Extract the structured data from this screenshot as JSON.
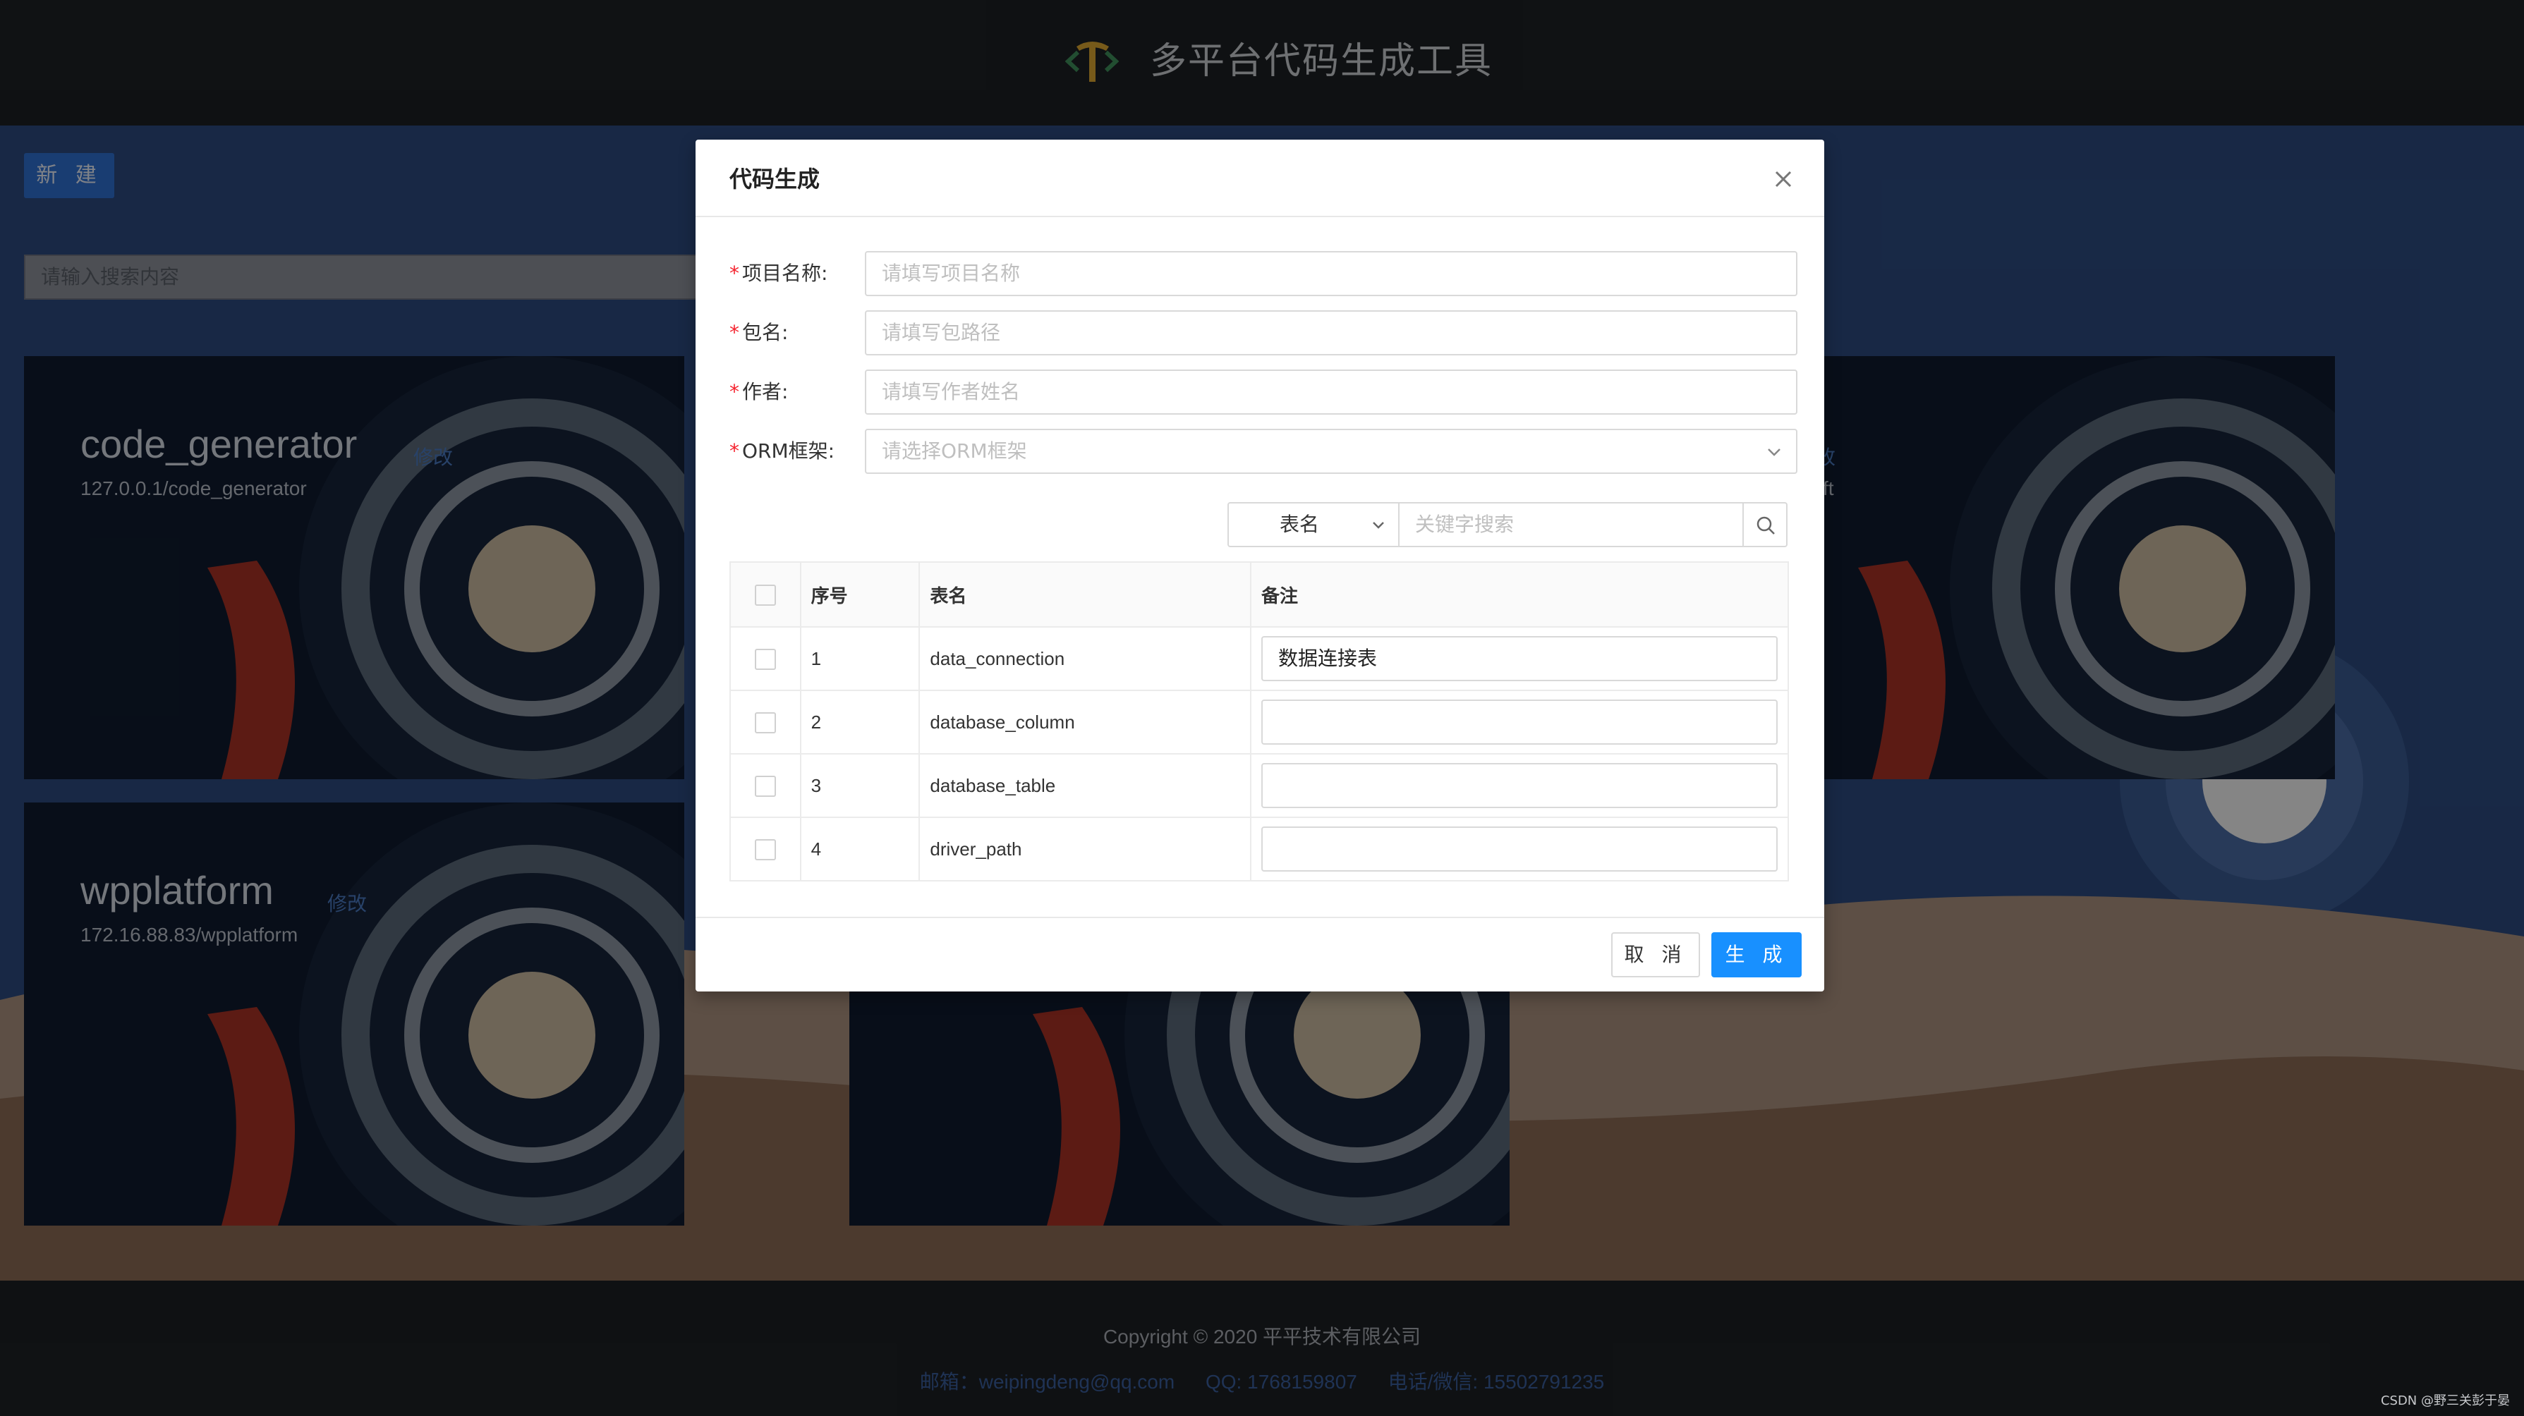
{
  "header": {
    "title": "多平台代码生成工具",
    "logo_icon": "pickaxe-code-logo"
  },
  "toolbar": {
    "new_label": "新 建",
    "search_placeholder": "请输入搜索内容"
  },
  "cards": [
    {
      "name": "code_generator",
      "edit_label": "修改",
      "url": "127.0.0.1/code_generator"
    },
    {
      "name": "wpplatform",
      "edit_label": "修改",
      "url": "172.16.88.83/wpplatform"
    },
    {
      "name_tail": "",
      "edit_label": "改",
      "url_tail": "ft"
    }
  ],
  "dialog": {
    "title": "代码生成",
    "fields": [
      {
        "label": "项目名称:",
        "placeholder": "请填写项目名称"
      },
      {
        "label": "包名:",
        "placeholder": "请填写包路径"
      },
      {
        "label": "作者:",
        "placeholder": "请填写作者姓名"
      },
      {
        "label": "ORM框架:",
        "placeholder": "请选择ORM框架"
      }
    ],
    "table_search": {
      "field": "表名",
      "placeholder": "关键字搜索"
    },
    "table": {
      "columns": [
        "序号",
        "表名",
        "备注"
      ],
      "rows": [
        {
          "index": "1",
          "name": "data_connection",
          "remark": "数据连接表"
        },
        {
          "index": "2",
          "name": "database_column",
          "remark": ""
        },
        {
          "index": "3",
          "name": "database_table",
          "remark": ""
        },
        {
          "index": "4",
          "name": "driver_path",
          "remark": ""
        }
      ]
    },
    "cancel_label": "取 消",
    "generate_label": "生 成"
  },
  "footer": {
    "copyright": "Copyright © 2020 平平技术有限公司",
    "email": "邮箱：weipingdeng@qq.com",
    "qq": "QQ: 1768159807",
    "phone": "电话/微信: 15502791235"
  },
  "watermark": "CSDN @野三关彭于晏",
  "colors": {
    "primary": "#1890ff",
    "required": "#f5222d",
    "header_bg": "#1d2024",
    "main_bg": "#2c4a7f"
  }
}
